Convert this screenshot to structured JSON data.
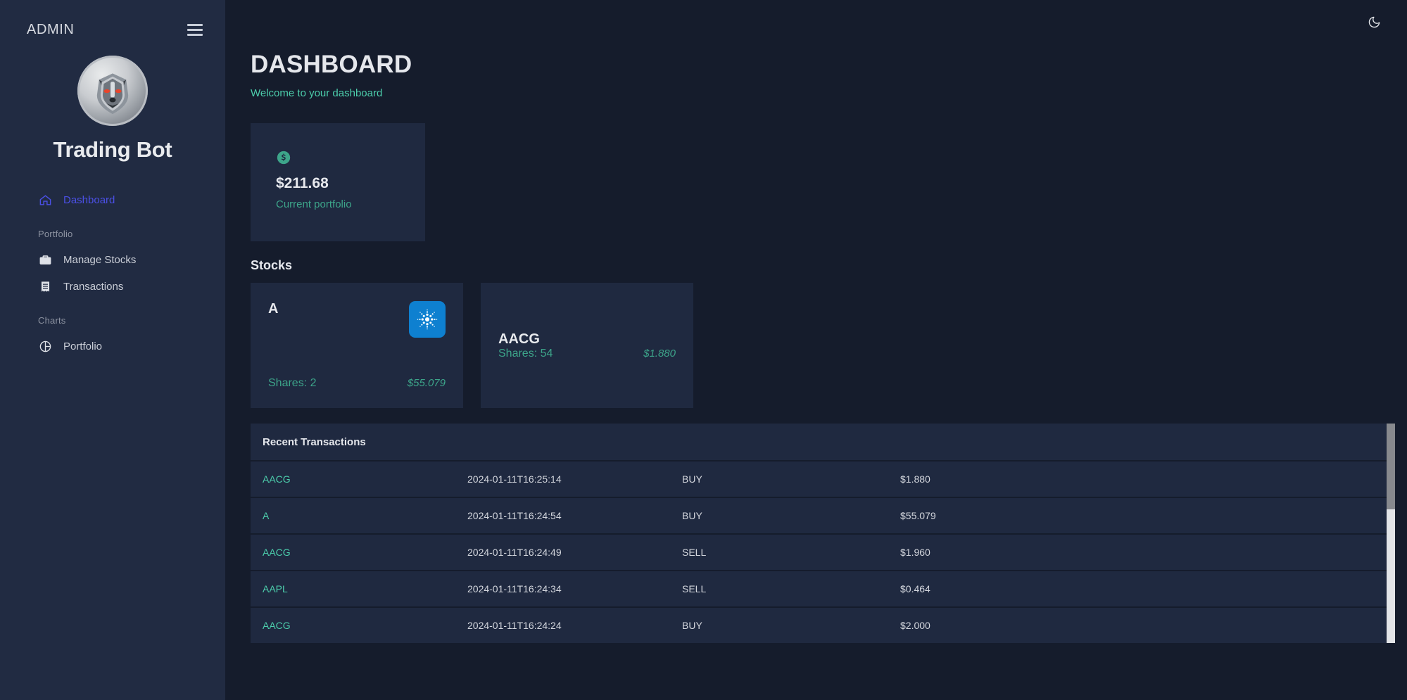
{
  "sidebar": {
    "admin_label": "ADMIN",
    "menu_icon": "hamburger-icon",
    "brand_title": "Trading Bot",
    "avatar_icon": "wolf-logo",
    "items": [
      {
        "label": "Dashboard",
        "icon": "home-icon",
        "active": true
      }
    ],
    "sections": [
      {
        "label": "Portfolio",
        "items": [
          {
            "label": "Manage Stocks",
            "icon": "briefcase-icon"
          },
          {
            "label": "Transactions",
            "icon": "receipt-icon"
          }
        ]
      },
      {
        "label": "Charts",
        "items": [
          {
            "label": "Portfolio",
            "icon": "pie-chart-icon"
          }
        ]
      }
    ]
  },
  "topbar": {
    "theme_toggle_icon": "moon-icon"
  },
  "header": {
    "title": "DASHBOARD",
    "subtitle": "Welcome to your dashboard"
  },
  "stat_card": {
    "icon": "dollar-circle-icon",
    "value": "$211.68",
    "label": "Current portfolio",
    "accent_color": "#3da58a"
  },
  "stocks": {
    "section_title": "Stocks",
    "cards": [
      {
        "symbol": "A",
        "shares": "Shares: 2",
        "price": "$55.079",
        "logo_icon": "agilent-starburst-icon",
        "logo_color": "#0e80d0",
        "has_logo": true
      },
      {
        "symbol": "AACG",
        "shares": "Shares: 54",
        "price": "$1.880",
        "has_logo": false
      }
    ]
  },
  "transactions": {
    "title": "Recent Transactions",
    "rows": [
      {
        "symbol": "AACG",
        "date": "2024-01-11T16:25:14",
        "type": "BUY",
        "price": "$1.880"
      },
      {
        "symbol": "A",
        "date": "2024-01-11T16:24:54",
        "type": "BUY",
        "price": "$55.079"
      },
      {
        "symbol": "AACG",
        "date": "2024-01-11T16:24:49",
        "type": "SELL",
        "price": "$1.960"
      },
      {
        "symbol": "AAPL",
        "date": "2024-01-11T16:24:34",
        "type": "SELL",
        "price": "$0.464"
      },
      {
        "symbol": "AACG",
        "date": "2024-01-11T16:24:24",
        "type": "BUY",
        "price": "$2.000"
      }
    ],
    "scrollbar_visible": true
  },
  "colors": {
    "sidebar_bg": "#212b42",
    "main_bg": "#151c2c",
    "card_bg": "#1f2940",
    "accent_green": "#4cceac",
    "accent_teal": "#3da58a",
    "accent_blue": "#4b50e6"
  }
}
